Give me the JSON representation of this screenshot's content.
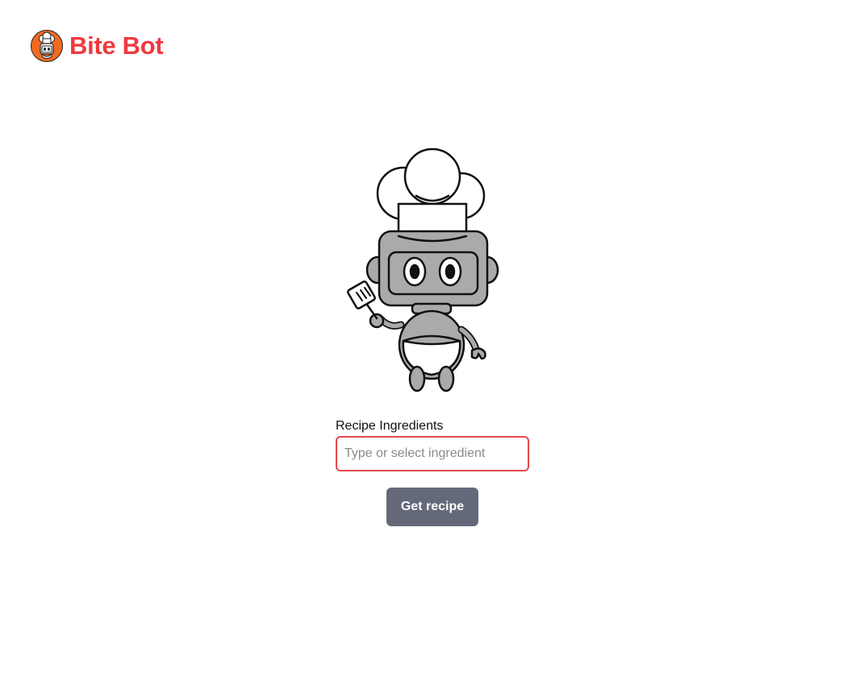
{
  "brand": {
    "name": "Bite Bot",
    "color": "#f0383f",
    "logo_icon": "robot-chef-logo-icon"
  },
  "illustration": {
    "icon": "robot-chef-mascot-icon"
  },
  "form": {
    "label": "Recipe Ingredients",
    "input_placeholder": "Type or select ingredient",
    "input_value": "",
    "input_border_color": "#e5484d",
    "submit_label": "Get recipe",
    "submit_color": "#64697a"
  }
}
